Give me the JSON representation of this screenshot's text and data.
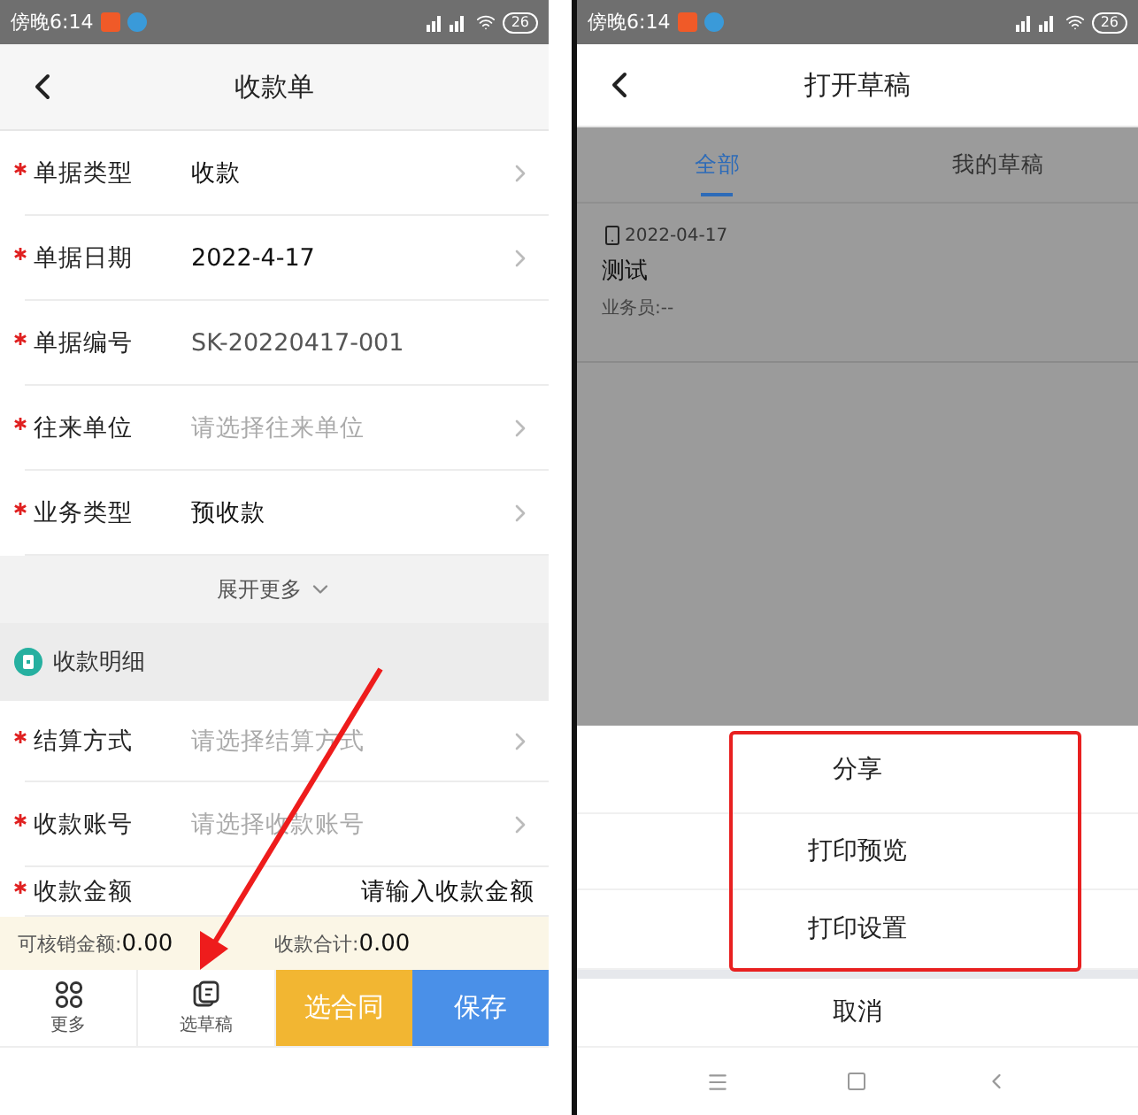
{
  "left_screen": {
    "status_bar": {
      "time": "傍晚6:14",
      "battery": "26"
    },
    "header": {
      "title": "收款单"
    },
    "fields": [
      {
        "label": "单据类型",
        "value": "收款",
        "kind": "value",
        "required": true,
        "chevron": true
      },
      {
        "label": "单据日期",
        "value": "2022-4-17",
        "kind": "value",
        "required": true,
        "chevron": true
      },
      {
        "label": "单据编号",
        "value": "SK-20220417-001",
        "kind": "readonly",
        "required": true,
        "chevron": false
      },
      {
        "label": "往来单位",
        "placeholder": "请选择往来单位",
        "kind": "placeholder",
        "required": true,
        "chevron": true
      },
      {
        "label": "业务类型",
        "value": "预收款",
        "kind": "value",
        "required": true,
        "chevron": true
      }
    ],
    "expand_link": "展开更多",
    "section": {
      "title": "收款明细"
    },
    "detail_fields": [
      {
        "label": "结算方式",
        "placeholder": "请选择结算方式",
        "kind": "placeholder",
        "required": true,
        "chevron": true
      },
      {
        "label": "收款账号",
        "placeholder": "请选择收款账号",
        "kind": "placeholder",
        "required": true,
        "chevron": true
      },
      {
        "label": "收款金额",
        "placeholder": "请输入收款金额",
        "kind": "input",
        "required": true,
        "chevron": false
      }
    ],
    "summary": [
      {
        "label": "可核销金额:",
        "value": "0.00"
      },
      {
        "label": "收款合计:",
        "value": "0.00"
      }
    ],
    "bottom_bar": [
      {
        "label": "更多",
        "kind": "icon"
      },
      {
        "label": "选草稿",
        "kind": "icon"
      },
      {
        "label": "选合同",
        "kind": "primary",
        "color": "#f2b632"
      },
      {
        "label": "保存",
        "kind": "primary",
        "color": "#4a90e8"
      }
    ]
  },
  "right_screen": {
    "status_bar": {
      "time": "傍晚6:14",
      "battery": "26"
    },
    "header": {
      "title": "打开草稿"
    },
    "tabs": [
      {
        "label": "全部",
        "selected": true
      },
      {
        "label": "我的草稿",
        "selected": false
      }
    ],
    "drafts": [
      {
        "date": "2022-04-17",
        "title": "测试",
        "salesperson": "业务员:--"
      }
    ],
    "action_sheet": {
      "items": [
        "分享",
        "打印预览",
        "打印设置"
      ],
      "cancel": "取消"
    }
  }
}
